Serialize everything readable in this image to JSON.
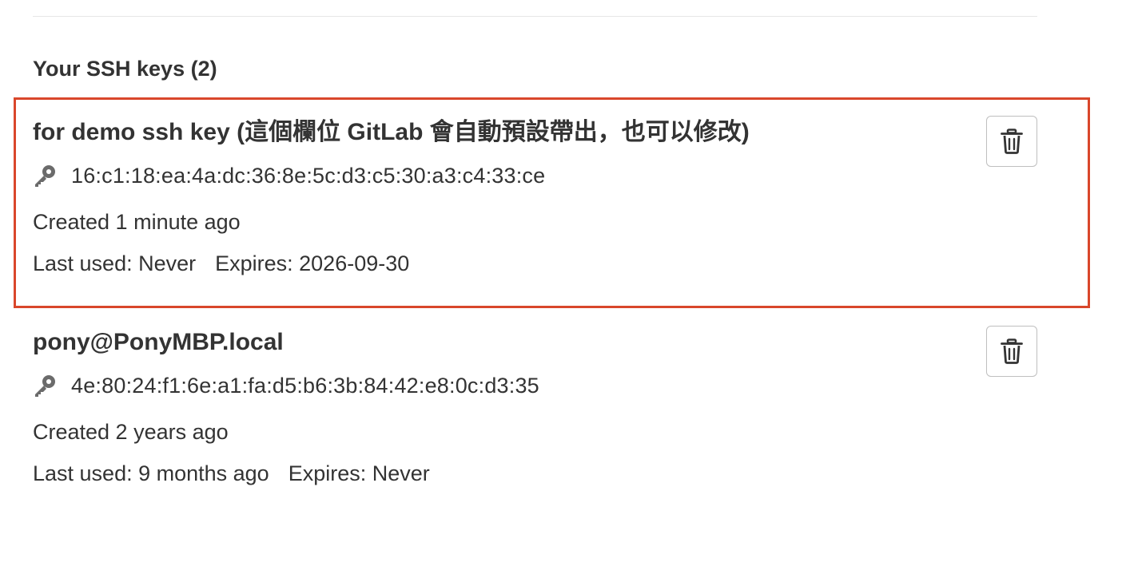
{
  "section": {
    "title": "Your SSH keys (2)"
  },
  "keys": [
    {
      "title": "for demo ssh key (這個欄位 GitLab 會自動預設帶出，也可以修改)",
      "fingerprint": "16:c1:18:ea:4a:dc:36:8e:5c:d3:c5:30:a3:c4:33:ce",
      "created": "Created 1 minute ago",
      "last_used": "Last used: Never",
      "expires": "Expires: 2026-09-30",
      "highlighted": true
    },
    {
      "title": "pony@PonyMBP.local",
      "fingerprint": "4e:80:24:f1:6e:a1:fa:d5:b6:3b:84:42:e8:0c:d3:35",
      "created": "Created 2 years ago",
      "last_used": "Last used: 9 months ago",
      "expires": "Expires: Never",
      "highlighted": false
    }
  ],
  "icons": {
    "key": "key-icon",
    "delete": "trash-icon"
  },
  "colors": {
    "highlight_border": "#d9472b",
    "text": "#333333",
    "button_border": "#bfbfbf"
  }
}
